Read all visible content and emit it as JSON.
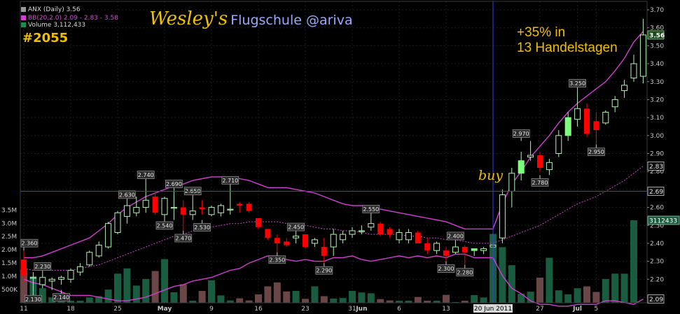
{
  "header": {
    "ticker_line": "ANX (Daily) 3.56",
    "bb_line": "BB(20,2.0) 2.09 - 2.83 - 3.58",
    "volume_line": "Volume 3,112,433"
  },
  "annotations": {
    "brand_name": "Wesley's",
    "brand_sub": "Flugschule @ariva",
    "post_number": "#2055",
    "gain_line1": "+35% in",
    "gain_line2": "13 Handelstagen",
    "buy_label": "buy"
  },
  "colors": {
    "background": "#000000",
    "up_candle": "#b6f0b6",
    "up_candle_highlight": "#7cff7c",
    "down_candle": "#ff0000",
    "bollinger": "#d040d0",
    "volume_up": "#1a5c40",
    "volume_down": "#6a4646",
    "crosshair": "#3a3aff",
    "annotation": "#f0c000"
  },
  "chart_data": {
    "type": "candlestick",
    "price_axis": {
      "range": [
        2.08,
        3.72
      ],
      "ticks": [
        "3.70",
        "3.60",
        "3.50",
        "3.40",
        "3.30",
        "3.20",
        "3.10",
        "3.00",
        "2.90",
        "2.80",
        "2.70",
        "2.60",
        "2.50",
        "2.40",
        "2.30",
        "2.20",
        "2.10"
      ],
      "tick_values": [
        3.7,
        3.6,
        3.5,
        3.4,
        3.3,
        3.2,
        3.1,
        3.0,
        2.9,
        2.8,
        2.7,
        2.6,
        2.5,
        2.4,
        2.3,
        2.2,
        2.1
      ],
      "markers": [
        {
          "label": "3.56",
          "value": 3.56
        },
        {
          "label": "2.83",
          "value": 2.83
        },
        {
          "label": "2.69",
          "value": 2.69
        },
        {
          "label": "2.09",
          "value": 2.09
        }
      ]
    },
    "volume_axis": {
      "range": [
        0,
        3800000
      ],
      "ticks": [
        "3.5M",
        "3.0M",
        "2.5M",
        "2.0M",
        "1.5M",
        "1.0M",
        "500K"
      ],
      "tick_values": [
        3500000,
        3000000,
        2500000,
        2000000,
        1500000,
        1000000,
        500000
      ],
      "marker": {
        "label": "3112433",
        "value": 3112433
      }
    },
    "x_axis_labels": [
      {
        "label": "11",
        "index": 0
      },
      {
        "label": "18",
        "index": 5
      },
      {
        "label": "25",
        "index": 10
      },
      {
        "label": "May",
        "index": 15
      },
      {
        "label": "9",
        "index": 20
      },
      {
        "label": "16",
        "index": 25
      },
      {
        "label": "23",
        "index": 30
      },
      {
        "label": "31",
        "index": 35
      },
      {
        "label": "Jun",
        "index": 36
      },
      {
        "label": "6",
        "index": 40
      },
      {
        "label": "13",
        "index": 45
      },
      {
        "label": "20 Jun 2011",
        "index": 50
      },
      {
        "label": "27",
        "index": 55
      },
      {
        "label": "Jul",
        "index": 59
      },
      {
        "label": "5",
        "index": 61
      }
    ],
    "crosshair": {
      "price": 2.69,
      "index": 50
    },
    "candles": [
      {
        "o": 2.31,
        "h": 2.36,
        "l": 2.18,
        "c": 2.22
      },
      {
        "o": 2.21,
        "h": 2.24,
        "l": 2.13,
        "c": 2.21
      },
      {
        "o": 2.17,
        "h": 2.23,
        "l": 2.15,
        "c": 2.21
      },
      {
        "o": 2.19,
        "h": 2.21,
        "l": 2.14,
        "c": 2.2
      },
      {
        "o": 2.2,
        "h": 2.22,
        "l": 2.17,
        "c": 2.21
      },
      {
        "o": 2.2,
        "h": 2.26,
        "l": 2.18,
        "c": 2.25
      },
      {
        "o": 2.24,
        "h": 2.29,
        "l": 2.22,
        "c": 2.27
      },
      {
        "o": 2.28,
        "h": 2.36,
        "l": 2.27,
        "c": 2.35
      },
      {
        "o": 2.33,
        "h": 2.41,
        "l": 2.32,
        "c": 2.39
      },
      {
        "o": 2.38,
        "h": 2.52,
        "l": 2.37,
        "c": 2.51
      },
      {
        "o": 2.46,
        "h": 2.58,
        "l": 2.45,
        "c": 2.57
      },
      {
        "o": 2.55,
        "h": 2.63,
        "l": 2.51,
        "c": 2.61
      },
      {
        "o": 2.57,
        "h": 2.66,
        "l": 2.55,
        "c": 2.6
      },
      {
        "o": 2.6,
        "h": 2.74,
        "l": 2.57,
        "c": 2.64
      },
      {
        "o": 2.66,
        "h": 2.69,
        "l": 2.56,
        "c": 2.57
      },
      {
        "o": 2.56,
        "h": 2.66,
        "l": 2.54,
        "c": 2.65
      },
      {
        "o": 2.6,
        "h": 2.69,
        "l": 2.53,
        "c": 2.6
      },
      {
        "o": 2.6,
        "h": 2.64,
        "l": 2.47,
        "c": 2.56
      },
      {
        "o": 2.56,
        "h": 2.65,
        "l": 2.53,
        "c": 2.58
      },
      {
        "o": 2.6,
        "h": 2.64,
        "l": 2.56,
        "c": 2.59
      },
      {
        "o": 2.56,
        "h": 2.61,
        "l": 2.55,
        "c": 2.6
      },
      {
        "o": 2.57,
        "h": 2.62,
        "l": 2.55,
        "c": 2.61
      },
      {
        "o": 2.59,
        "h": 2.71,
        "l": 2.56,
        "c": 2.59
      },
      {
        "o": 2.62,
        "h": 2.63,
        "l": 2.57,
        "c": 2.61
      },
      {
        "o": 2.62,
        "h": 2.63,
        "l": 2.57,
        "c": 2.58
      },
      {
        "o": 2.54,
        "h": 2.54,
        "l": 2.48,
        "c": 2.49
      },
      {
        "o": 2.48,
        "h": 2.48,
        "l": 2.42,
        "c": 2.43
      },
      {
        "o": 2.43,
        "h": 2.45,
        "l": 2.35,
        "c": 2.4
      },
      {
        "o": 2.41,
        "h": 2.43,
        "l": 2.38,
        "c": 2.39
      },
      {
        "o": 2.43,
        "h": 2.45,
        "l": 2.4,
        "c": 2.44
      },
      {
        "o": 2.45,
        "h": 2.45,
        "l": 2.37,
        "c": 2.38
      },
      {
        "o": 2.4,
        "h": 2.43,
        "l": 2.38,
        "c": 2.42
      },
      {
        "o": 2.38,
        "h": 2.43,
        "l": 2.29,
        "c": 2.33
      },
      {
        "o": 2.38,
        "h": 2.48,
        "l": 2.33,
        "c": 2.45
      },
      {
        "o": 2.42,
        "h": 2.47,
        "l": 2.4,
        "c": 2.45
      },
      {
        "o": 2.45,
        "h": 2.49,
        "l": 2.43,
        "c": 2.47
      },
      {
        "o": 2.47,
        "h": 2.5,
        "l": 2.45,
        "c": 2.47
      },
      {
        "o": 2.49,
        "h": 2.55,
        "l": 2.47,
        "c": 2.51
      },
      {
        "o": 2.51,
        "h": 2.52,
        "l": 2.44,
        "c": 2.45
      },
      {
        "o": 2.48,
        "h": 2.49,
        "l": 2.43,
        "c": 2.45
      },
      {
        "o": 2.42,
        "h": 2.48,
        "l": 2.4,
        "c": 2.46
      },
      {
        "o": 2.42,
        "h": 2.48,
        "l": 2.4,
        "c": 2.46
      },
      {
        "o": 2.46,
        "h": 2.47,
        "l": 2.4,
        "c": 2.4
      },
      {
        "o": 2.4,
        "h": 2.43,
        "l": 2.34,
        "c": 2.36
      },
      {
        "o": 2.36,
        "h": 2.41,
        "l": 2.34,
        "c": 2.4
      },
      {
        "o": 2.36,
        "h": 2.38,
        "l": 2.3,
        "c": 2.33
      },
      {
        "o": 2.35,
        "h": 2.4,
        "l": 2.34,
        "c": 2.38
      },
      {
        "o": 2.38,
        "h": 2.39,
        "l": 2.28,
        "c": 2.35
      },
      {
        "o": 2.36,
        "h": 2.36,
        "l": 2.33,
        "c": 2.37
      },
      {
        "o": 2.36,
        "h": 2.38,
        "l": 2.34,
        "c": 2.37
      },
      {
        "o": 2.38,
        "h": 2.4,
        "l": 2.35,
        "c": 2.39
      },
      {
        "o": 2.43,
        "h": 2.7,
        "l": 2.4,
        "c": 2.67
      },
      {
        "o": 2.69,
        "h": 2.82,
        "l": 2.6,
        "c": 2.79
      },
      {
        "o": 2.79,
        "h": 2.91,
        "l": 2.75,
        "c": 2.86
      },
      {
        "o": 2.88,
        "h": 2.97,
        "l": 2.86,
        "c": 2.89
      },
      {
        "o": 2.89,
        "h": 2.91,
        "l": 2.8,
        "c": 2.82
      },
      {
        "o": 2.81,
        "h": 2.87,
        "l": 2.78,
        "c": 2.85
      },
      {
        "o": 2.9,
        "h": 3.03,
        "l": 2.88,
        "c": 3.0
      },
      {
        "o": 3.0,
        "h": 3.13,
        "l": 2.97,
        "c": 3.1
      },
      {
        "o": 3.09,
        "h": 3.25,
        "l": 3.05,
        "c": 3.15
      },
      {
        "o": 3.15,
        "h": 3.18,
        "l": 2.99,
        "c": 3.01
      },
      {
        "o": 3.08,
        "h": 3.13,
        "l": 2.95,
        "c": 3.03
      },
      {
        "o": 3.07,
        "h": 3.14,
        "l": 3.06,
        "c": 3.13
      },
      {
        "o": 3.16,
        "h": 3.22,
        "l": 3.13,
        "c": 3.2
      },
      {
        "o": 3.25,
        "h": 3.31,
        "l": 3.21,
        "c": 3.28
      },
      {
        "o": 3.32,
        "h": 3.45,
        "l": 3.3,
        "c": 3.4
      },
      {
        "o": 3.33,
        "h": 3.65,
        "l": 3.29,
        "c": 3.56
      }
    ],
    "up_highlight_indices": [
      48,
      53,
      58
    ],
    "volume": [
      1250000,
      1000000,
      550000,
      200000,
      250000,
      80000,
      80000,
      200000,
      250000,
      500000,
      1100000,
      1300000,
      650000,
      900000,
      1200000,
      1650000,
      400000,
      700000,
      80000,
      450000,
      850000,
      280000,
      90000,
      170000,
      90000,
      320000,
      620000,
      770000,
      430000,
      450000,
      150000,
      620000,
      250000,
      160000,
      180000,
      450000,
      390000,
      360000,
      140000,
      90000,
      80000,
      80000,
      220000,
      80000,
      80000,
      300000,
      30000,
      80000,
      290000,
      200000,
      2600000,
      2100000,
      1420000,
      340000,
      420000,
      950000,
      1700000,
      470000,
      320000,
      550000,
      620000,
      410000,
      900000,
      1100000,
      1100000,
      3112433
    ],
    "bb_upper": [
      2.32,
      2.32,
      2.33,
      2.35,
      2.37,
      2.39,
      2.41,
      2.43,
      2.47,
      2.51,
      2.56,
      2.6,
      2.63,
      2.66,
      2.68,
      2.7,
      2.72,
      2.73,
      2.75,
      2.76,
      2.77,
      2.77,
      2.77,
      2.76,
      2.75,
      2.73,
      2.71,
      2.71,
      2.71,
      2.7,
      2.69,
      2.68,
      2.66,
      2.64,
      2.62,
      2.61,
      2.61,
      2.6,
      2.59,
      2.58,
      2.57,
      2.56,
      2.55,
      2.54,
      2.53,
      2.52,
      2.5,
      2.48,
      2.48,
      2.48,
      2.48,
      2.62,
      2.73,
      2.8,
      2.88,
      2.94,
      3.0,
      3.07,
      3.13,
      3.18,
      3.22,
      3.26,
      3.3,
      3.36,
      3.43,
      3.52,
      3.58
    ],
    "bb_middle": [
      2.26,
      2.25,
      2.25,
      2.25,
      2.25,
      2.25,
      2.26,
      2.27,
      2.28,
      2.3,
      2.32,
      2.34,
      2.36,
      2.38,
      2.4,
      2.42,
      2.44,
      2.45,
      2.47,
      2.48,
      2.49,
      2.5,
      2.51,
      2.51,
      2.52,
      2.52,
      2.52,
      2.52,
      2.51,
      2.5,
      2.5,
      2.49,
      2.48,
      2.48,
      2.47,
      2.47,
      2.46,
      2.45,
      2.45,
      2.45,
      2.45,
      2.44,
      2.44,
      2.43,
      2.43,
      2.42,
      2.42,
      2.41,
      2.4,
      2.4,
      2.4,
      2.42,
      2.44,
      2.46,
      2.48,
      2.5,
      2.53,
      2.56,
      2.59,
      2.62,
      2.64,
      2.66,
      2.69,
      2.72,
      2.75,
      2.79,
      2.83
    ],
    "bb_lower": [
      2.2,
      2.18,
      2.17,
      2.15,
      2.13,
      2.11,
      2.11,
      2.11,
      2.1,
      2.09,
      2.08,
      2.08,
      2.09,
      2.1,
      2.12,
      2.14,
      2.16,
      2.17,
      2.19,
      2.2,
      2.21,
      2.23,
      2.25,
      2.26,
      2.29,
      2.31,
      2.33,
      2.33,
      2.31,
      2.3,
      2.31,
      2.3,
      2.3,
      2.32,
      2.32,
      2.33,
      2.31,
      2.3,
      2.31,
      2.32,
      2.33,
      2.32,
      2.33,
      2.32,
      2.33,
      2.32,
      2.34,
      2.34,
      2.32,
      2.32,
      2.32,
      2.22,
      2.15,
      2.12,
      2.08,
      2.06,
      2.06,
      2.05,
      2.05,
      2.06,
      2.06,
      2.06,
      2.08,
      2.08,
      2.07,
      2.06,
      2.09
    ],
    "callouts": [
      {
        "label": "2.360",
        "index": 0,
        "value": 2.36,
        "pos": "above"
      },
      {
        "label": "2.130",
        "index": 1,
        "value": 2.13,
        "pos": "below"
      },
      {
        "label": "2.230",
        "index": 2,
        "value": 2.23,
        "pos": "above"
      },
      {
        "label": "2.140",
        "index": 4,
        "value": 2.14,
        "pos": "below"
      },
      {
        "label": "2.630",
        "index": 11,
        "value": 2.63,
        "pos": "above"
      },
      {
        "label": "2.740",
        "index": 13,
        "value": 2.74,
        "pos": "above"
      },
      {
        "label": "2.540",
        "index": 15,
        "value": 2.54,
        "pos": "below"
      },
      {
        "label": "2.690",
        "index": 16,
        "value": 2.69,
        "pos": "above"
      },
      {
        "label": "2.470",
        "index": 17,
        "value": 2.47,
        "pos": "below"
      },
      {
        "label": "2.650",
        "index": 18,
        "value": 2.65,
        "pos": "above"
      },
      {
        "label": "2.530",
        "index": 19,
        "value": 2.53,
        "pos": "below"
      },
      {
        "label": "2.710",
        "index": 22,
        "value": 2.71,
        "pos": "above"
      },
      {
        "label": "2.350",
        "index": 27,
        "value": 2.35,
        "pos": "below"
      },
      {
        "label": "2.450",
        "index": 29,
        "value": 2.45,
        "pos": "above"
      },
      {
        "label": "2.290",
        "index": 32,
        "value": 2.29,
        "pos": "below"
      },
      {
        "label": "2.550",
        "index": 37,
        "value": 2.55,
        "pos": "above"
      },
      {
        "label": "2.300",
        "index": 45,
        "value": 2.3,
        "pos": "below"
      },
      {
        "label": "2.400",
        "index": 46,
        "value": 2.4,
        "pos": "above"
      },
      {
        "label": "2.280",
        "index": 47,
        "value": 2.28,
        "pos": "below"
      },
      {
        "label": "2.780",
        "index": 55,
        "value": 2.78,
        "pos": "below"
      },
      {
        "label": "2.970",
        "index": 53,
        "value": 2.97,
        "pos": "above"
      },
      {
        "label": "3.250",
        "index": 59,
        "value": 3.25,
        "pos": "above"
      },
      {
        "label": "2.950",
        "index": 61,
        "value": 2.95,
        "pos": "below"
      }
    ]
  }
}
